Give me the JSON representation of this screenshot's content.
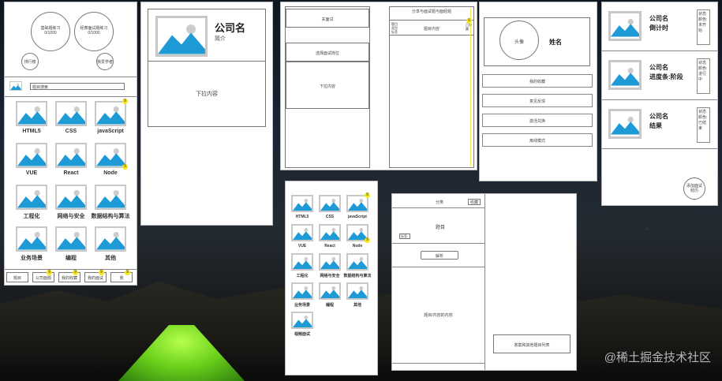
{
  "panel1": {
    "circle1_title": "基础题练习",
    "circle1_count": "0/1000",
    "circle2_title": "经典面试题练习",
    "circle2_count": "0/1000",
    "ranking": "排行榜",
    "plan": "我爱学者",
    "search_placeholder": "题目搜索",
    "categories": [
      "HTML5",
      "CSS",
      "javaScript",
      "VUE",
      "React",
      "Node",
      "工程化",
      "网络与安全",
      "数据结构与算法",
      "业务场景",
      "编程",
      "其他"
    ],
    "badges": [
      "9",
      "9"
    ],
    "nav": [
      "题目",
      "公司面题",
      "我的收藏",
      "我的面试",
      "我"
    ],
    "nav_badges": [
      "9",
      "9",
      "9",
      "9"
    ]
  },
  "panel2": {
    "company": "公司名",
    "intro": "简介",
    "dropdown": "下拉内容"
  },
  "panel3": {
    "form": "关面试",
    "role": "选择面试岗位",
    "pulldown": "下拉内容",
    "header": "分享与面试题与面经题",
    "sub_left": "题目\n类型\n标签",
    "sub_mid": "题目内容",
    "sub_right": "已收\n藏",
    "badge": "9"
  },
  "panel4": {
    "avatar": "头像",
    "name": "姓名",
    "menu": [
      "我的收藏",
      "意见反馈",
      "激活兑换",
      "离线模式"
    ]
  },
  "panel5": {
    "rows": [
      {
        "company": "公司名",
        "sub": "倒计时",
        "status": "状态\n颜色:\n未开\n始"
      },
      {
        "company": "公司名",
        "sub": "进度条:阶段",
        "status": "状态\n颜色:\n进行\n中"
      },
      {
        "company": "公司名",
        "sub": "结果",
        "status": "状态\n颜色:\n已结\n束"
      }
    ],
    "add": "添加面试\n经历"
  },
  "panel6": {
    "categories": [
      "HTML5",
      "CSS",
      "javaScript",
      "VUE",
      "React",
      "Node",
      "工程化",
      "网络与安全",
      "数据结构与算法",
      "业务场景",
      "编程",
      "其他",
      "视频面试"
    ],
    "badges": [
      "9",
      "9"
    ]
  },
  "panel7": {
    "tab_left": "分类",
    "tab_right": "收藏",
    "title": "题目",
    "tag": "标签",
    "answer_btn": "解析",
    "content": "题目/内容的内容",
    "side_note": "答案和其他题目列表"
  },
  "watermark": "@稀土掘金技术社区"
}
